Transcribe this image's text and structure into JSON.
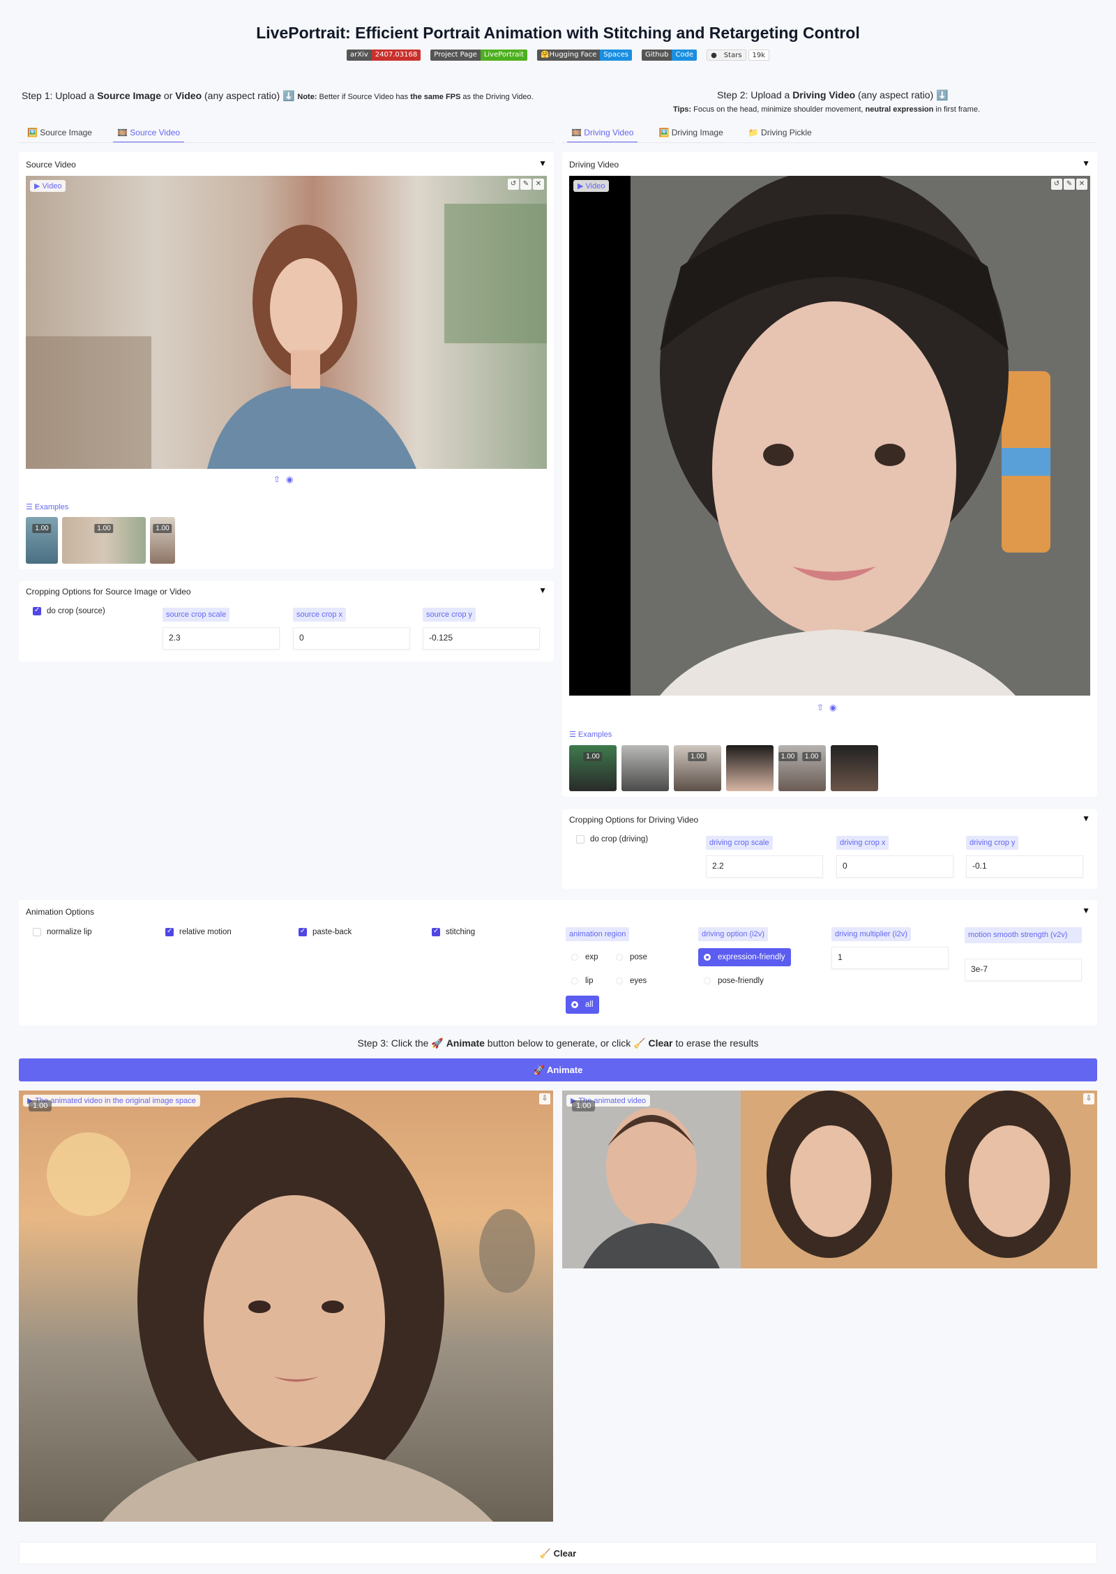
{
  "title": "LivePortrait: Efficient Portrait Animation with Stitching and Retargeting Control",
  "badges": [
    {
      "left": "arXiv",
      "right": "2407.03168",
      "color": "#c9302c"
    },
    {
      "left": "Project Page",
      "right": "LivePortrait",
      "color": "#4caf1e"
    },
    {
      "left": "🤗Hugging Face",
      "right": "Spaces",
      "color": "#1a8ee0"
    },
    {
      "left": "Github",
      "right": "Code",
      "color": "#1a8ee0"
    }
  ],
  "stars": {
    "label": "Stars",
    "count": "19k"
  },
  "step1": {
    "prefix": "Step 1: Upload a ",
    "b1": "Source Image",
    "mid": " or ",
    "b2": "Video",
    "suffix": " (any aspect ratio) ⬇️ ",
    "note_b": "Note:",
    "note_text": " Better if Source Video has ",
    "note_b2": "the same FPS",
    "note_end": " as the Driving Video."
  },
  "step2": {
    "prefix": "Step 2: Upload a ",
    "b1": "Driving Video",
    "suffix": " (any aspect ratio) ⬇️",
    "tips_b": "Tips:",
    "tips_text": " Focus on the head, minimize shoulder movement, ",
    "tips_b2": "neutral expression",
    "tips_end": " in first frame."
  },
  "source_tabs": [
    "🖼️ Source Image",
    "🎞️ Source Video"
  ],
  "driving_tabs": [
    "🎞️ Driving Video",
    "🖼️ Driving Image",
    "📁 Driving Pickle"
  ],
  "source_video": {
    "label": "Source Video",
    "chip": "Video",
    "examples": "Examples",
    "thumb_labels": [
      "1.00",
      "1.00",
      "1.00"
    ]
  },
  "driving_video": {
    "label": "Driving Video",
    "chip": "Video",
    "examples": "Examples",
    "thumb_labels": [
      "1.00",
      "",
      "1.00",
      "",
      "1.00",
      "1.00",
      ""
    ]
  },
  "source_crop": {
    "label": "Cropping Options for Source Image or Video",
    "do_crop": "do crop (source)",
    "scale_label": "source crop scale",
    "scale": "2.3",
    "x_label": "source crop x",
    "x": "0",
    "y_label": "source crop y",
    "y": "-0.125"
  },
  "driving_crop": {
    "label": "Cropping Options for Driving Video",
    "do_crop": "do crop (driving)",
    "scale_label": "driving crop scale",
    "scale": "2.2",
    "x_label": "driving crop x",
    "x": "0",
    "y_label": "driving crop y",
    "y": "-0.1"
  },
  "animation": {
    "label": "Animation Options",
    "normalize_lip": "normalize lip",
    "relative_motion": "relative motion",
    "paste_back": "paste-back",
    "stitching": "stitching",
    "region_label": "animation region",
    "regions": [
      "exp",
      "pose",
      "lip",
      "eyes",
      "all"
    ],
    "drv_option_label": "driving option (i2v)",
    "drv_options": [
      "expression-friendly",
      "pose-friendly"
    ],
    "multiplier_label": "driving multiplier (i2v)",
    "multiplier": "1",
    "smooth_label": "motion smooth strength (v2v)",
    "smooth": "3e-7"
  },
  "step3": {
    "prefix": "Step 3: Click the 🚀 ",
    "b1": "Animate",
    "mid": " button below to generate, or click 🧹 ",
    "b2": "Clear",
    "suffix": " to erase the results"
  },
  "animate_button": "🚀 Animate",
  "clear_button": "🧹 Clear",
  "output1": {
    "chip": "The animated video in the original image space",
    "rate": "1.00"
  },
  "output2": {
    "chip": "The animated video",
    "rate": "1.00"
  },
  "icons": {
    "upload": "upload-icon",
    "webcam": "webcam-icon",
    "download": "download-icon"
  }
}
